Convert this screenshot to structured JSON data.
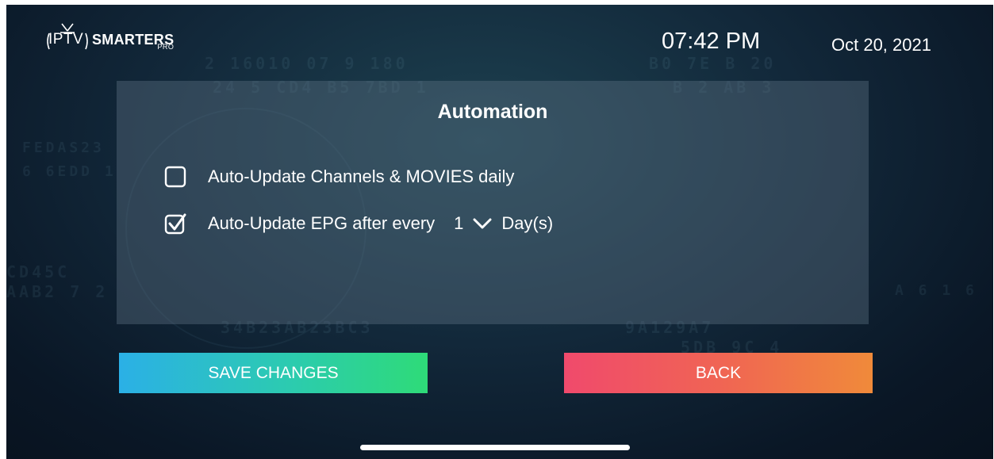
{
  "app": {
    "logo_iptv": "IPTV",
    "logo_smarters": "SMARTERS",
    "logo_pro": "PRO"
  },
  "status": {
    "time": "07:42 PM",
    "date": "Oct 20, 2021"
  },
  "panel": {
    "title": "Automation",
    "options": [
      {
        "label": "Auto-Update Channels & MOVIES daily",
        "checked": false
      },
      {
        "label": "Auto-Update EPG after every",
        "checked": true
      }
    ],
    "interval": {
      "value": "1",
      "unit": "Day(s)"
    }
  },
  "buttons": {
    "save_label": "SAVE CHANGES",
    "back_label": "BACK"
  },
  "colors": {
    "save_gradient": [
      "#2bb0e6",
      "#2edb78"
    ],
    "back_gradient": [
      "#f04a6c",
      "#f08a3a"
    ],
    "text": "#ffffff"
  },
  "icons": {
    "checkbox_unchecked": "checkbox-empty-icon",
    "checkbox_checked": "checkbox-checked-icon",
    "dropdown": "chevron-down-icon",
    "logo_antenna": "tv-antenna-icon"
  }
}
